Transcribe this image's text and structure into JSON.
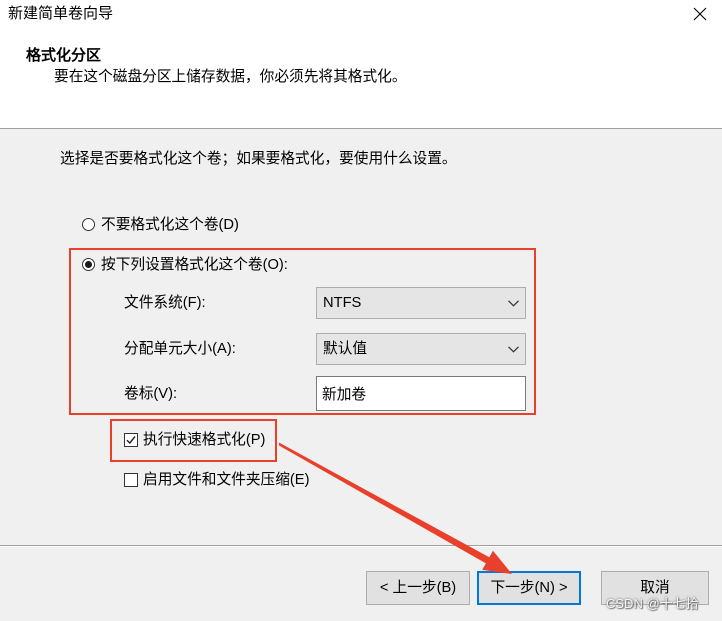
{
  "window": {
    "title": "新建简单卷向导"
  },
  "header": {
    "title": "格式化分区",
    "subtitle": "要在这个磁盘分区上储存数据，你必须先将其格式化。"
  },
  "body": {
    "instruction": "选择是否要格式化这个卷；如果要格式化，要使用什么设置。",
    "options": {
      "no_format": {
        "label": "不要格式化这个卷(D)",
        "selected": false
      },
      "format": {
        "label": "按下列设置格式化这个卷(O):",
        "selected": true
      }
    },
    "settings": {
      "file_system": {
        "label": "文件系统(F):",
        "value": "NTFS"
      },
      "allocation_unit_size": {
        "label": "分配单元大小(A):",
        "value": "默认值"
      },
      "volume_label": {
        "label": "卷标(V):",
        "value": "新加卷"
      }
    },
    "checkboxes": {
      "quick_format": {
        "label": "执行快速格式化(P)",
        "checked": true
      },
      "compression": {
        "label": "启用文件和文件夹压缩(E)",
        "checked": false
      }
    }
  },
  "footer": {
    "back_label": "< 上一步(B)",
    "next_label": "下一步(N) >",
    "cancel_label": "取消"
  },
  "watermark": "CSDN @十七拾",
  "icons": {
    "close": "close-icon",
    "dropdown": "chevron-down-icon",
    "check": "checkmark-icon"
  },
  "colors": {
    "annotation_red": "#e8402b",
    "accent": "#0078d7",
    "body_bg": "#f0f0f0"
  }
}
